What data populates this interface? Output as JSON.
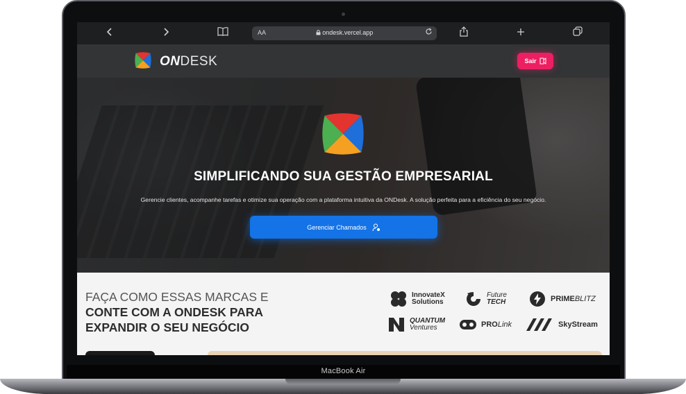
{
  "device": {
    "label": "MacBook Air"
  },
  "browser": {
    "back_icon": "chevron-left-icon",
    "forward_icon": "chevron-right-icon",
    "reader_icon": "book-icon",
    "text_size_label": "AA",
    "url": "ondesk.vercel.app",
    "lock_icon": "lock-icon",
    "reload_icon": "reload-icon",
    "share_icon": "share-icon",
    "new_tab_icon": "plus-icon",
    "tabs_icon": "tabs-icon"
  },
  "header": {
    "logo_bold": "ON",
    "logo_light": "DESK",
    "logout_label": "Sair",
    "logout_icon": "logout-icon"
  },
  "hero": {
    "title": "SIMPLIFICANDO SUA GESTÃO EMPRESARIAL",
    "subtitle": "Gerencie clientes, acompanhe tarefas e otimize sua operação com a plataforma intuitiva da ONDesk. A solução perfeita para a eficiência do seu negócio.",
    "cta_label": "Gerenciar Chamados",
    "cta_icon": "user-settings-icon"
  },
  "brands": {
    "heading_line1": "FAÇA COMO ESSAS MARCAS E",
    "heading_line2": "CONTE COM A ONDESK PARA",
    "heading_line3": "EXPANDIR O SEU NEGÓCIO",
    "items": [
      {
        "line1": "InnovateX",
        "line2": "Solutions",
        "icon": "innovatex-logo-icon"
      },
      {
        "line1": "Future",
        "line2": "TECH",
        "icon": "futuretech-logo-icon"
      },
      {
        "line1": "PRIME",
        "line2": "BLITZ",
        "icon": "primeblitz-logo-icon"
      },
      {
        "line1": "QUANTUM",
        "line2": "Ventures",
        "icon": "quantum-logo-icon"
      },
      {
        "line1": "PRO",
        "line2": "Link",
        "icon": "prolink-logo-icon"
      },
      {
        "line1": "SkyStream",
        "line2": "",
        "icon": "skystream-logo-icon"
      }
    ]
  },
  "colors": {
    "accent_blue": "#1473e6",
    "accent_pink": "#ec1f63",
    "logo_red": "#e3342f",
    "logo_blue": "#1e6fd9",
    "logo_green": "#4caf50",
    "logo_orange": "#f5a020"
  }
}
